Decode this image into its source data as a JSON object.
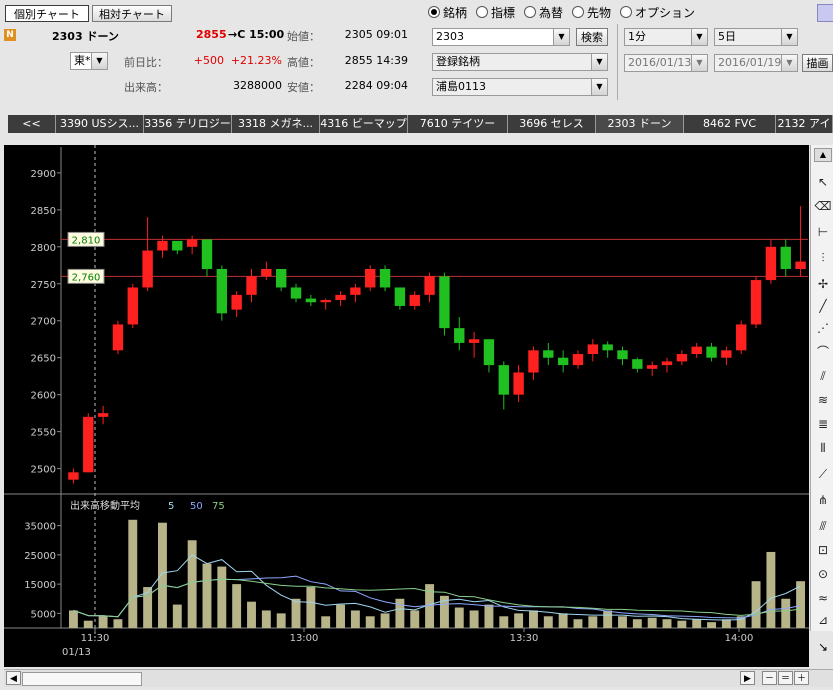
{
  "header": {
    "tab_individual": "個別チャート",
    "tab_relative": "相対チャート",
    "market_badge": "N",
    "code_name": "2303 ドーン",
    "price": "2855",
    "price_time": "→C 15:00",
    "open_label": "始値：",
    "open_value": "2305 09:01",
    "exchange": "東*",
    "change_label": "前日比：",
    "change_value": "+500",
    "change_pct": "+21.23%",
    "high_label": "高値：",
    "high_value": "2855 14:39",
    "volume_label": "出来高：",
    "volume_value": "3288000",
    "low_label": "安値：",
    "low_value": "2284 09:04"
  },
  "radios": [
    {
      "label": "銘柄",
      "selected": true
    },
    {
      "label": "指標",
      "selected": false
    },
    {
      "label": "為替",
      "selected": false
    },
    {
      "label": "先物",
      "selected": false
    },
    {
      "label": "オプション",
      "selected": false
    }
  ],
  "controls": {
    "code_input": "2303",
    "search_button": "検索",
    "registered": "登録銘柄",
    "list_name": "浦島0113",
    "interval": "1分",
    "span": "5日",
    "date_from": "2016/01/13",
    "date_to": "2016/01/19",
    "draw_button": "描画"
  },
  "stock_tabs": [
    "<<",
    "3390 USシス...",
    "3356 テリロジー",
    "3318 メガネ...",
    "4316 ビーマップ",
    "7610 テイツー",
    "3696 セレス",
    "2303 ドーン",
    "8462 FVC",
    "2132 アイ"
  ],
  "active_stock_tab": 7,
  "colors": {
    "up": "#ff2020",
    "down": "#20c020",
    "volume": "#b8b48a",
    "ma5": "#9fd6f0",
    "ma50": "#8ea8ff",
    "ma75": "#8ad08a"
  },
  "chart_data": {
    "type": "candlestick",
    "y_ticks": [
      2900,
      2850,
      2800,
      2750,
      2700,
      2650,
      2600,
      2550,
      2500
    ],
    "ylim": [
      2467,
      2935
    ],
    "x_ticks": [
      "11:30",
      "13:00",
      "13:30",
      "14:00"
    ],
    "date_label": "01/13",
    "price_lines": [
      {
        "value": 2810,
        "label": "2,810"
      },
      {
        "value": 2760,
        "label": "2,760"
      }
    ],
    "volume_title": "出来高移動平均",
    "ma_periods": [
      "5",
      "50",
      "75"
    ],
    "volume_ticks": [
      "35000",
      "25000",
      "15000",
      "5000"
    ],
    "volume_ylim": [
      0,
      40000
    ],
    "candles": [
      [
        2485,
        2500,
        2480,
        2495
      ],
      [
        2495,
        2575,
        2495,
        2570
      ],
      [
        2570,
        2585,
        2560,
        2575
      ],
      [
        2660,
        2700,
        2655,
        2695
      ],
      [
        2695,
        2750,
        2690,
        2745
      ],
      [
        2745,
        2840,
        2740,
        2795
      ],
      [
        2795,
        2815,
        2785,
        2808
      ],
      [
        2808,
        2800,
        2790,
        2795
      ],
      [
        2800,
        2815,
        2790,
        2810
      ],
      [
        2810,
        2790,
        2760,
        2770
      ],
      [
        2770,
        2775,
        2700,
        2710
      ],
      [
        2715,
        2740,
        2705,
        2735
      ],
      [
        2735,
        2770,
        2725,
        2760
      ],
      [
        2760,
        2780,
        2755,
        2770
      ],
      [
        2770,
        2765,
        2740,
        2745
      ],
      [
        2745,
        2750,
        2725,
        2730
      ],
      [
        2730,
        2735,
        2720,
        2725
      ],
      [
        2725,
        2730,
        2715,
        2728
      ],
      [
        2728,
        2740,
        2720,
        2735
      ],
      [
        2735,
        2750,
        2725,
        2745
      ],
      [
        2745,
        2775,
        2740,
        2770
      ],
      [
        2770,
        2775,
        2740,
        2745
      ],
      [
        2745,
        2745,
        2715,
        2720
      ],
      [
        2720,
        2740,
        2715,
        2735
      ],
      [
        2735,
        2765,
        2725,
        2760
      ],
      [
        2760,
        2765,
        2680,
        2690
      ],
      [
        2690,
        2705,
        2660,
        2670
      ],
      [
        2670,
        2685,
        2650,
        2675
      ],
      [
        2675,
        2670,
        2630,
        2640
      ],
      [
        2640,
        2645,
        2580,
        2600
      ],
      [
        2600,
        2640,
        2590,
        2630
      ],
      [
        2630,
        2665,
        2620,
        2660
      ],
      [
        2660,
        2670,
        2640,
        2650
      ],
      [
        2650,
        2660,
        2630,
        2640
      ],
      [
        2640,
        2660,
        2635,
        2655
      ],
      [
        2655,
        2675,
        2645,
        2668
      ],
      [
        2668,
        2672,
        2650,
        2660
      ],
      [
        2660,
        2665,
        2640,
        2648
      ],
      [
        2648,
        2650,
        2630,
        2635
      ],
      [
        2635,
        2645,
        2625,
        2640
      ],
      [
        2640,
        2650,
        2630,
        2645
      ],
      [
        2645,
        2660,
        2640,
        2655
      ],
      [
        2655,
        2670,
        2650,
        2665
      ],
      [
        2665,
        2670,
        2645,
        2650
      ],
      [
        2650,
        2665,
        2640,
        2660
      ],
      [
        2660,
        2700,
        2655,
        2695
      ],
      [
        2695,
        2760,
        2690,
        2755
      ],
      [
        2755,
        2810,
        2750,
        2800
      ],
      [
        2800,
        2810,
        2760,
        2770
      ],
      [
        2770,
        2855,
        2760,
        2780
      ]
    ],
    "volumes": [
      6000,
      2500,
      4000,
      3000,
      37000,
      14000,
      36000,
      8000,
      30000,
      22000,
      21000,
      15000,
      9000,
      6000,
      5000,
      10000,
      14000,
      4000,
      8000,
      6000,
      4000,
      5000,
      10000,
      6000,
      15000,
      11000,
      7000,
      6000,
      8000,
      4000,
      5000,
      6000,
      4000,
      5000,
      3000,
      4000,
      6000,
      4000,
      3000,
      3500,
      3000,
      2500,
      3000,
      2000,
      3000,
      4000,
      16000,
      26000,
      10000,
      16000
    ]
  }
}
